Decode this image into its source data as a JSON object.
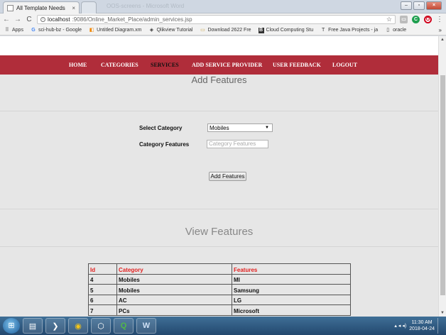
{
  "browser": {
    "tab_title": "All Template Needs",
    "tab_close": "×",
    "blurred_window_title": "OOS-screens - Microsoft Word",
    "window_controls": {
      "minimize": "–",
      "maximize": "▫",
      "close": "×"
    },
    "nav": {
      "back": "←",
      "forward": "→",
      "reload": "C"
    },
    "url_host": "localhost",
    "url_path": ":9086/Online_Market_Place/admin_services.jsp",
    "page_icon": "i",
    "star": "☆",
    "extensions": [
      "▭",
      "C",
      "O"
    ],
    "menu": "⋮",
    "bookmarks": [
      {
        "icon": "⠿",
        "label": "Apps"
      },
      {
        "icon": "G",
        "label": "sci-hub-bz - Google"
      },
      {
        "icon": "◧",
        "label": "Untitled Diagram.xm"
      },
      {
        "icon": "◈",
        "label": "Qlikview Tutorial"
      },
      {
        "icon": "▭",
        "label": "Download 2622 Fre"
      },
      {
        "icon": "B",
        "label": "Cloud Computing Stu"
      },
      {
        "icon": "T",
        "label": "Free Java Projects - ja"
      },
      {
        "icon": "▯",
        "label": "oracle"
      }
    ],
    "bookmarks_more": "»"
  },
  "navbar": {
    "items": [
      {
        "label": "HOME"
      },
      {
        "label": "CATEGORIES"
      },
      {
        "label": "SERVICES"
      },
      {
        "label": "ADD SERVICE PROVIDER"
      },
      {
        "label": "USER FEEDBACK"
      },
      {
        "label": "LOGOUT"
      }
    ],
    "active": "SERVICES",
    "color": "#b02d3a"
  },
  "add_section": {
    "title": "Add Features",
    "category_label": "Select Category",
    "category_value": "Mobiles",
    "select_arrow": "▼",
    "features_label": "Category Features",
    "features_placeholder": "Category Features",
    "button_label": "Add Features"
  },
  "view_section": {
    "title": "View Features",
    "columns": [
      "Id",
      "Category",
      "Features"
    ],
    "rows": [
      [
        "4",
        "Mobiles",
        "MI"
      ],
      [
        "5",
        "Mobiles",
        "Samsung"
      ],
      [
        "6",
        "AC",
        "LG"
      ],
      [
        "7",
        "PCs",
        "Microsoft"
      ]
    ],
    "header_color": "#e2201f"
  },
  "scrollbar": {
    "up": "▲",
    "down": "▼"
  },
  "taskbar": {
    "start": "⊞",
    "apps": [
      "▤",
      "❯",
      "◉",
      "⬡",
      "Q",
      "W"
    ],
    "tray_icons": "▴ ◂ ◂)",
    "time": "11:30 AM",
    "date": "2018-04-24"
  }
}
